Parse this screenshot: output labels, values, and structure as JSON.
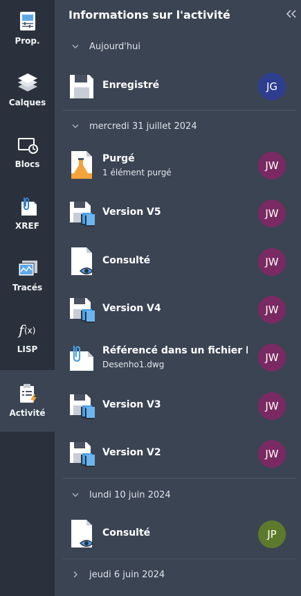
{
  "colors": {
    "sidebar_bg": "#2b313c",
    "panel_bg": "#3b4453",
    "avatar_jg": "#2d3e8f",
    "avatar_jw": "#7a2a62",
    "avatar_jp": "#5d7a2c",
    "accent_blue": "#4a9fe6",
    "accent_orange": "#f2a33a"
  },
  "sidebar": {
    "items": [
      {
        "label": "Prop.",
        "icon": "properties-icon"
      },
      {
        "label": "Calques",
        "icon": "layers-icon"
      },
      {
        "label": "Blocs",
        "icon": "blocks-icon"
      },
      {
        "label": "XREF",
        "icon": "xref-icon"
      },
      {
        "label": "Tracés",
        "icon": "traces-icon"
      },
      {
        "label": "LISP",
        "icon": "lisp-icon"
      },
      {
        "label": "Activité",
        "icon": "activity-icon",
        "active": true
      }
    ]
  },
  "panel": {
    "title": "Informations sur l'activité",
    "collapse_icon": "double-chevron-left-icon"
  },
  "groups": [
    {
      "label": "Aujourd'hui",
      "expanded": true,
      "items": [
        {
          "title": "Enregistré",
          "subtitle": "",
          "icon": "save-icon",
          "initials": "JG",
          "avatar_color": "#2d3e8f"
        }
      ]
    },
    {
      "label": "mercredi 31 juillet 2024",
      "expanded": true,
      "items": [
        {
          "title": "Purgé",
          "subtitle": "1 élément purgé",
          "icon": "purge-icon",
          "initials": "JW",
          "avatar_color": "#7a2a62"
        },
        {
          "title": "Version V5",
          "subtitle": "",
          "icon": "version-icon",
          "initials": "JW",
          "avatar_color": "#7a2a62"
        },
        {
          "title": "Consulté",
          "subtitle": "",
          "icon": "viewed-icon",
          "initials": "JW",
          "avatar_color": "#7a2a62"
        },
        {
          "title": "Version V4",
          "subtitle": "",
          "icon": "version-icon",
          "initials": "JW",
          "avatar_color": "#7a2a62"
        },
        {
          "title": "Référencé dans un fichier DWG",
          "subtitle": "Desenho1.dwg",
          "icon": "referenced-icon",
          "initials": "JW",
          "avatar_color": "#7a2a62"
        },
        {
          "title": "Version V3",
          "subtitle": "",
          "icon": "version-icon",
          "initials": "JW",
          "avatar_color": "#7a2a62"
        },
        {
          "title": "Version V2",
          "subtitle": "",
          "icon": "version-icon",
          "initials": "JW",
          "avatar_color": "#7a2a62"
        }
      ]
    },
    {
      "label": "lundi 10 juin 2024",
      "expanded": true,
      "items": [
        {
          "title": "Consulté",
          "subtitle": "",
          "icon": "viewed-icon",
          "initials": "JP",
          "avatar_color": "#5d7a2c"
        }
      ]
    },
    {
      "label": "jeudi 6 juin 2024",
      "expanded": false,
      "items": []
    }
  ]
}
